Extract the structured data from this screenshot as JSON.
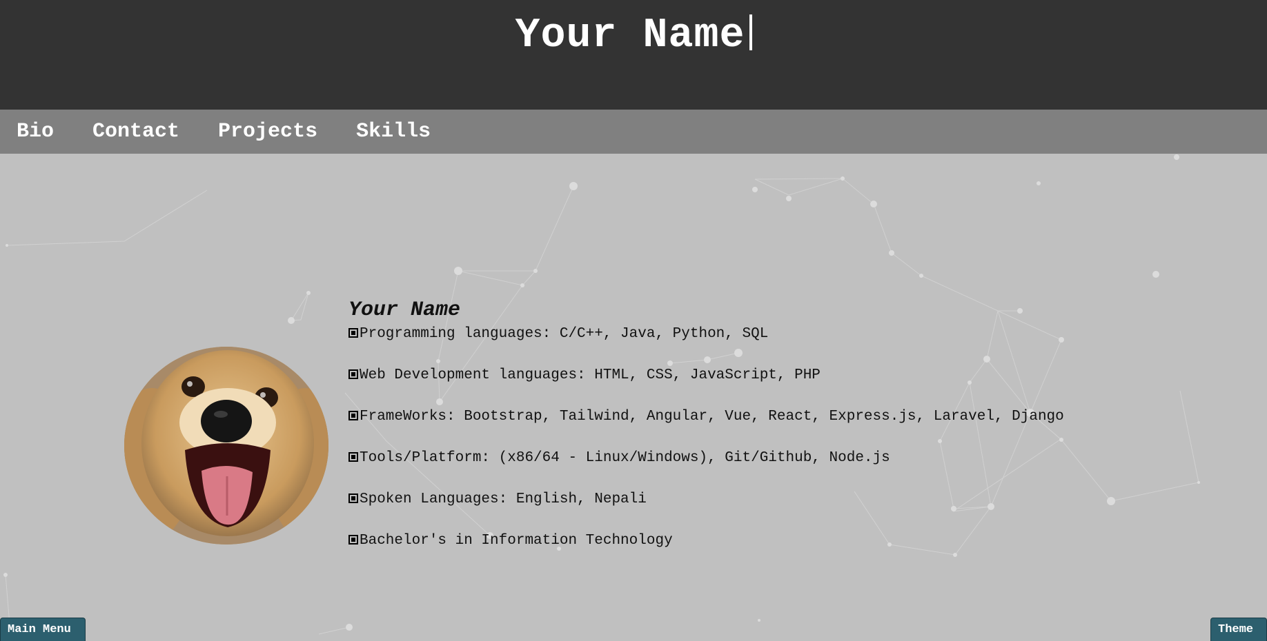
{
  "header": {
    "title": "Your Name"
  },
  "nav": {
    "items": [
      "Bio",
      "Contact",
      "Projects",
      "Skills"
    ]
  },
  "profile": {
    "name": "Your Name",
    "avatar_icon": "golden-retriever-puppy-photo",
    "skills": [
      "Programming languages: C/C++, Java, Python, SQL",
      "Web Development languages: HTML, CSS, JavaScript, PHP",
      "FrameWorks: Bootstrap, Tailwind, Angular, Vue, React, Express.js, Laravel, Django",
      "Tools/Platform: (x86/64 - Linux/Windows), Git/Github, Node.js",
      "Spoken Languages: English, Nepali",
      "Bachelor's in Information Technology"
    ]
  },
  "buttons": {
    "main_menu": "Main Menu",
    "theme": "Theme"
  },
  "colors": {
    "header": "#333333",
    "nav": "#808080",
    "background": "#c0c0c0",
    "button": "#2c5f6e"
  }
}
